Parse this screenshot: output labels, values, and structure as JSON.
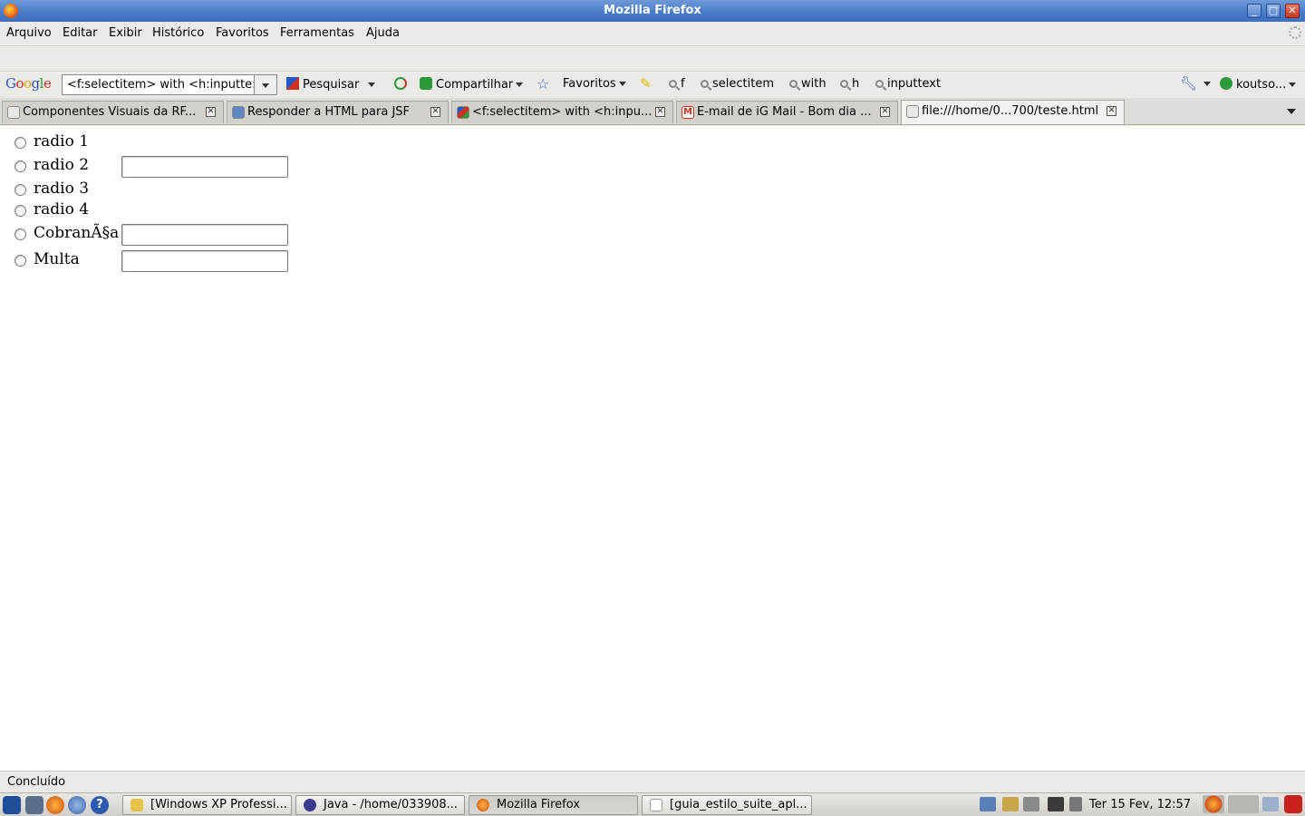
{
  "window": {
    "title": "Mozilla Firefox"
  },
  "menu": [
    "Arquivo",
    "Editar",
    "Exibir",
    "Histórico",
    "Favoritos",
    "Ferramentas",
    "Ajuda"
  ],
  "google_toolbar": {
    "logo": "Google",
    "search_value": "<f:selectitem> with <h:inputte:",
    "search_button": "Pesquisar",
    "share_button": "Compartilhar",
    "favorites_button": "Favoritos",
    "highlight_terms": [
      "f",
      "selectitem",
      "with",
      "h",
      "inputtext"
    ],
    "account": "koutso..."
  },
  "tabs": [
    {
      "title": "Componentes Visuais da RF...",
      "active": false
    },
    {
      "title": "Responder a HTML para JSF",
      "active": false
    },
    {
      "title": "<f:selectitem> with <h:inpu...",
      "active": false
    },
    {
      "title": "E-mail de iG Mail - Bom dia ...",
      "active": false
    },
    {
      "title": "file:///home/0...700/teste.html",
      "active": true
    }
  ],
  "page": {
    "options": [
      {
        "label": "radio 1",
        "has_input": false
      },
      {
        "label": "radio 2",
        "has_input": true
      },
      {
        "label": "radio 3",
        "has_input": false
      },
      {
        "label": "radio 4",
        "has_input": false
      },
      {
        "label": "CobranÃ§a",
        "has_input": true
      },
      {
        "label": "Multa",
        "has_input": true
      }
    ]
  },
  "status": "Concluído",
  "taskbar": {
    "windows": [
      {
        "title": "[Windows XP Professi...",
        "active": false
      },
      {
        "title": "Java - /home/033908...",
        "active": false
      },
      {
        "title": "Mozilla Firefox",
        "active": true
      },
      {
        "title": "[guia_estilo_suite_apl...",
        "active": false
      }
    ],
    "clock": "Ter 15 Fev, 12:57"
  },
  "colors": {
    "titlebar": "#4a7cc9",
    "close_button": "#c2381e"
  }
}
